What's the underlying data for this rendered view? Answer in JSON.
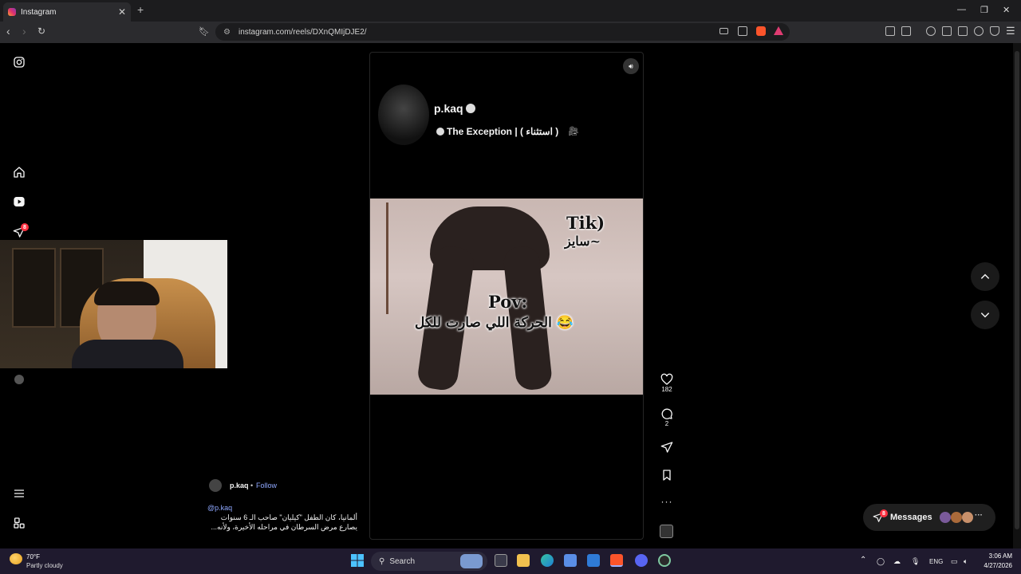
{
  "browser": {
    "tab_title": "Instagram",
    "url": "instagram.com/reels/DXnQMIjDJE2/"
  },
  "sidebar": {
    "notification_count": "8"
  },
  "reel": {
    "profile_name": "p.kaq",
    "profile_subtitle": "The Exception | ( استثناء )",
    "video_text_top": "Tik)",
    "video_text_top2": "سايز~",
    "video_text_pov": "Pov:",
    "video_text_arabic": "الحركة اللي صارت للكل 😂",
    "author": "p.kaq",
    "follow_label": "Follow",
    "mention": "@p.kaq",
    "caption_line1": "ألمانيا، كان الطفل \"كيليان\" صاحب الـ 6 سنوات",
    "caption_line2": "...يصارع مرض السرطان في مراحله الأخيرة، ولأنه",
    "likes": "182",
    "comments": "2"
  },
  "messages": {
    "label": "Messages",
    "badge": "8"
  },
  "taskbar": {
    "weather_temp": "70°F",
    "weather_desc": "Partly cloudy",
    "search_label": "Search",
    "language": "ENG",
    "time": "3:06 AM",
    "date": "4/27/2026"
  },
  "colors": {
    "accent": "#ff3040",
    "link": "#8fa8ff",
    "background": "#000000"
  }
}
